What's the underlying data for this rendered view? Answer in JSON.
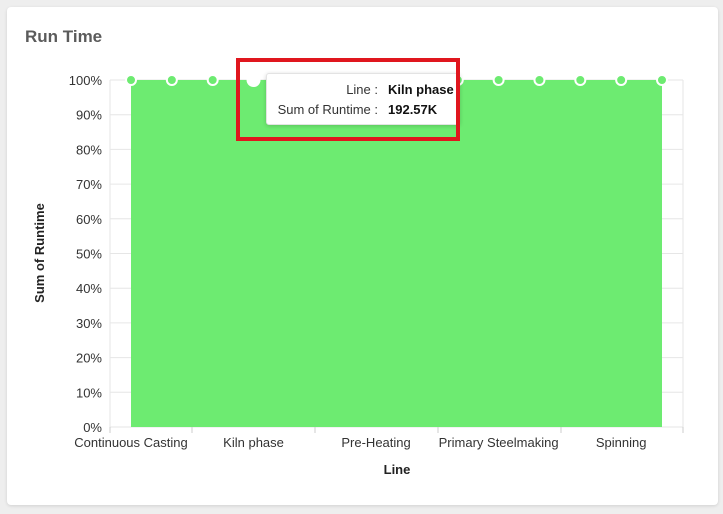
{
  "card": {
    "title": "Run Time"
  },
  "tooltip": {
    "line_label": "Line :",
    "line_value": "Kiln phase",
    "runtime_label": "Sum of Runtime :",
    "runtime_value": "192.57K"
  },
  "colors": {
    "area": "#6deb71",
    "grid": "#e6e6e6",
    "highlight": "#e0161e"
  },
  "chart_data": {
    "type": "area",
    "title": "Run Time",
    "xlabel": "Line",
    "ylabel": "Sum of Runtime",
    "y_ticks": [
      "0%",
      "10%",
      "20%",
      "30%",
      "40%",
      "50%",
      "60%",
      "70%",
      "80%",
      "90%",
      "100%"
    ],
    "ylim": [
      0,
      100
    ],
    "x_tick_labels": [
      "Continuous Casting",
      "Kiln phase",
      "Pre-Heating",
      "Primary Steelmaking",
      "Spinning"
    ],
    "x_count": 14,
    "x_label_indices": [
      0,
      3,
      6,
      9,
      12
    ],
    "highlight_index": 3,
    "series": [
      {
        "values": [
          100,
          100,
          100,
          100,
          100,
          100,
          100,
          100,
          100,
          100,
          100,
          100,
          100,
          100
        ]
      }
    ],
    "stacked_percent": true,
    "grid": true,
    "legend": "none"
  }
}
